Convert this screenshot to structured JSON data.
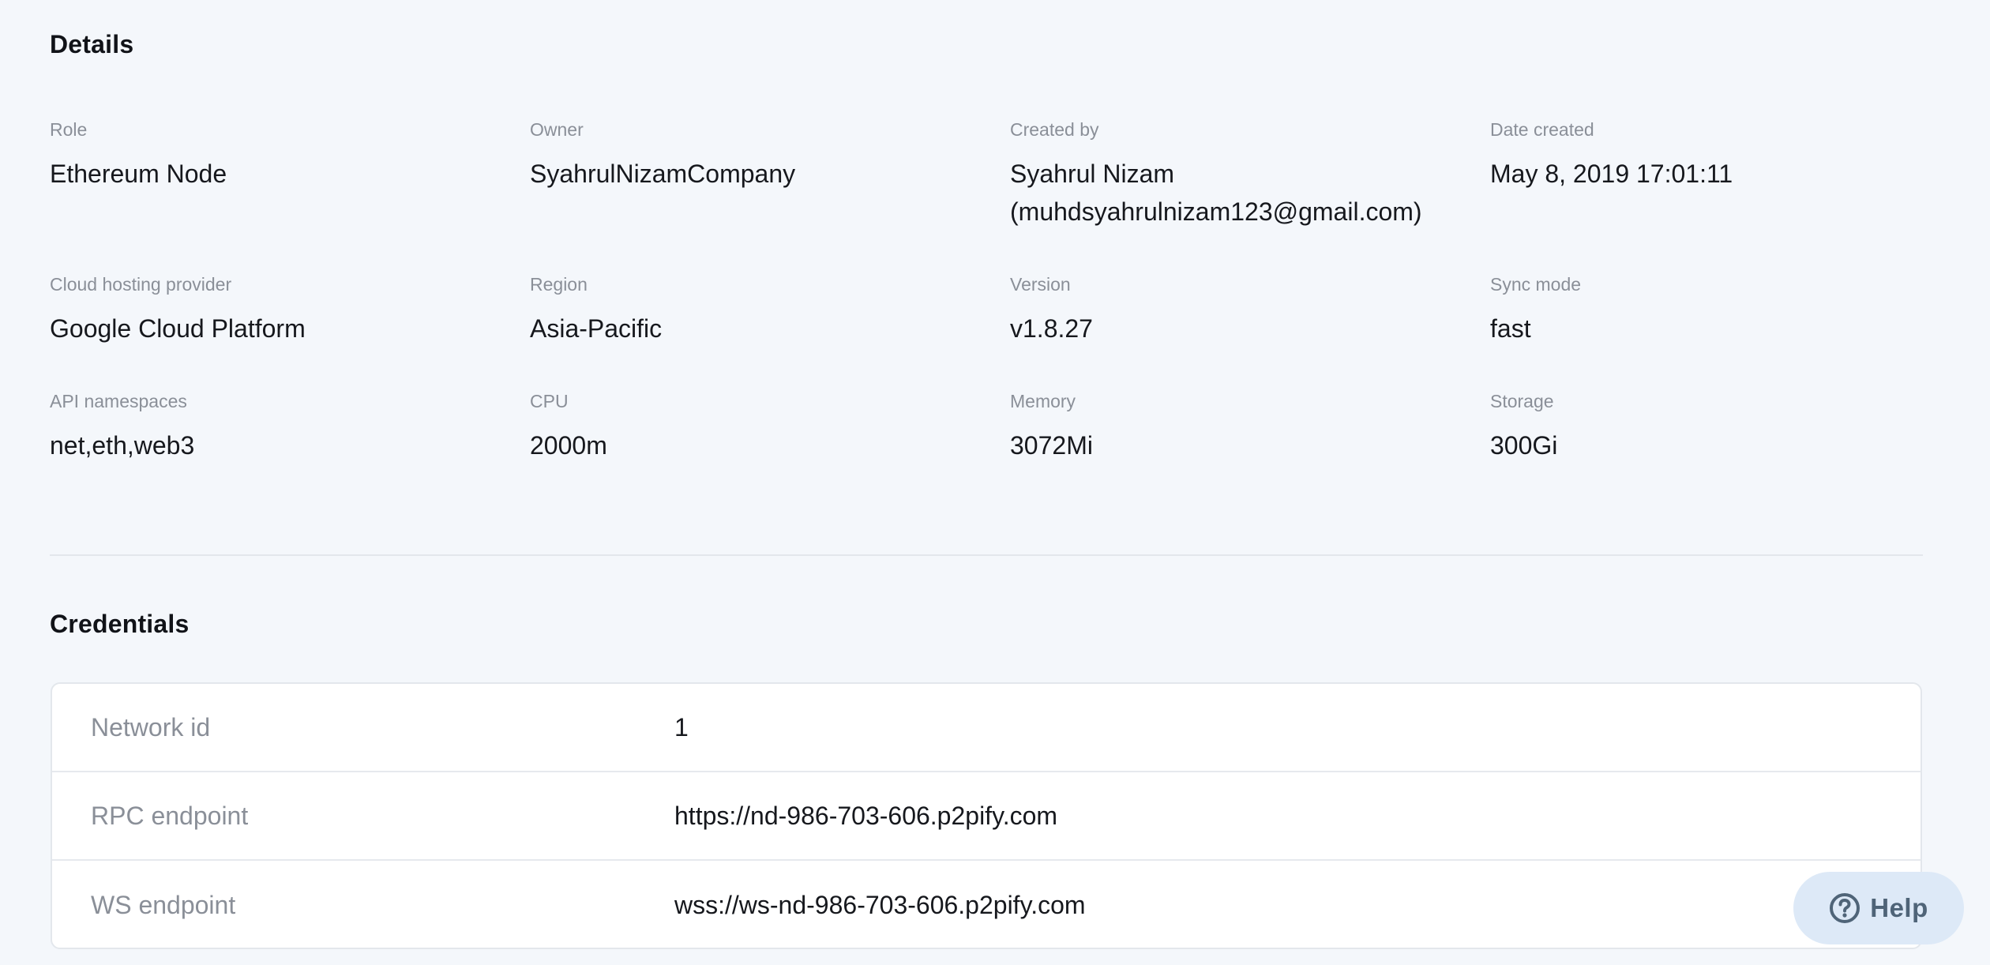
{
  "details": {
    "title": "Details",
    "fields": {
      "role": {
        "label": "Role",
        "value": "Ethereum Node"
      },
      "owner": {
        "label": "Owner",
        "value": "SyahrulNizamCompany"
      },
      "created_by": {
        "label": "Created by",
        "value": "Syahrul Nizam\n(muhdsyahrulnizam123@gmail.com)"
      },
      "date_created": {
        "label": "Date created",
        "value": "May 8, 2019 17:01:11"
      },
      "cloud_provider": {
        "label": "Cloud hosting provider",
        "value": "Google Cloud Platform"
      },
      "region": {
        "label": "Region",
        "value": "Asia-Pacific"
      },
      "version": {
        "label": "Version",
        "value": "v1.8.27"
      },
      "sync_mode": {
        "label": "Sync mode",
        "value": "fast"
      },
      "api_namespaces": {
        "label": "API namespaces",
        "value": "net,eth,web3"
      },
      "cpu": {
        "label": "CPU",
        "value": "2000m"
      },
      "memory": {
        "label": "Memory",
        "value": "3072Mi"
      },
      "storage": {
        "label": "Storage",
        "value": "300Gi"
      }
    }
  },
  "credentials": {
    "title": "Credentials",
    "rows": [
      {
        "key": "Network id",
        "value": "1"
      },
      {
        "key": "RPC endpoint",
        "value": "https://nd-986-703-606.p2pify.com"
      },
      {
        "key": "WS endpoint",
        "value": "wss://ws-nd-986-703-606.p2pify.com"
      }
    ]
  },
  "help": {
    "label": "Help",
    "icon": "question-circle-icon"
  },
  "colors": {
    "background": "#f4f7fb",
    "help_bg": "#dde9f7",
    "help_fg": "#4f6478",
    "label": "#8a8f98"
  }
}
